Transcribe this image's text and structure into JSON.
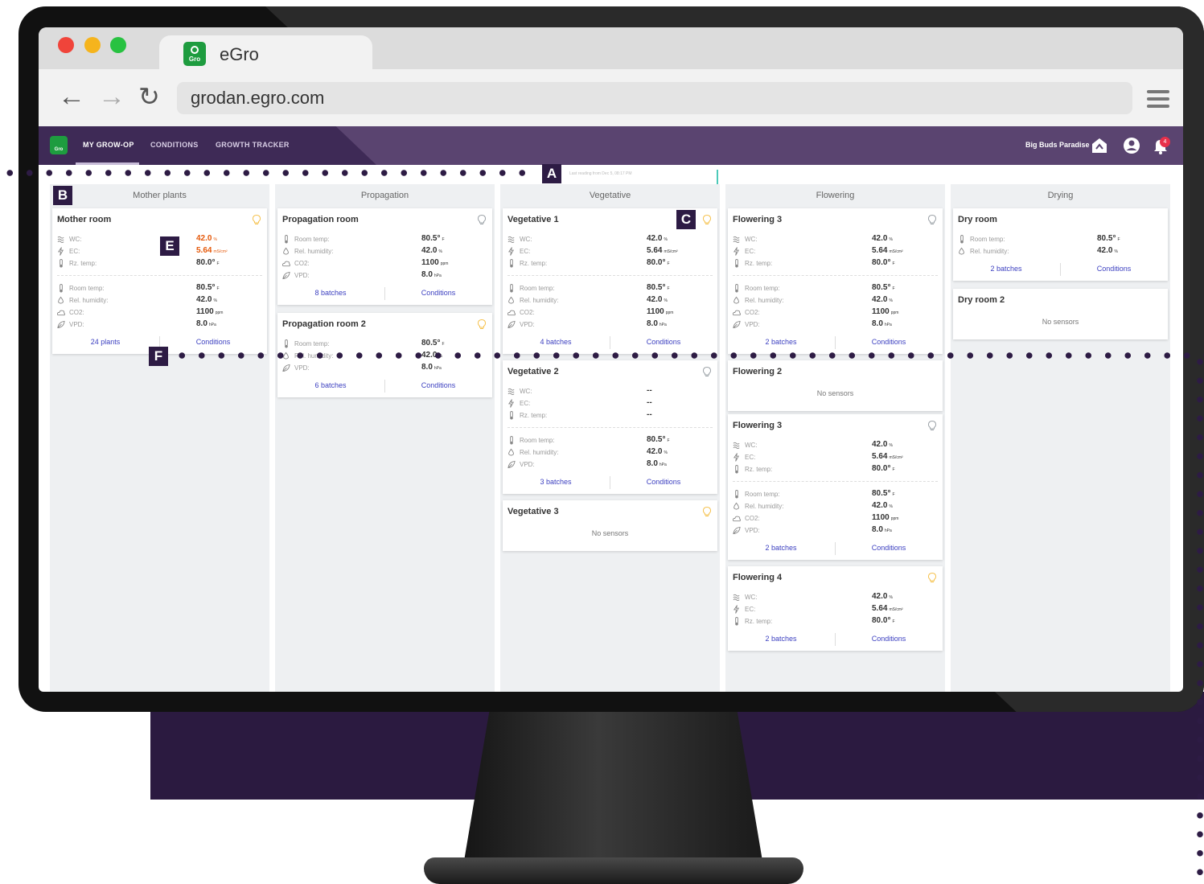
{
  "browser": {
    "tab_title": "eGro",
    "logo_text": "Gro",
    "url": "grodan.egro.com"
  },
  "app": {
    "logo_text": "Gro",
    "nav": [
      "MY GROW-OP",
      "CONDITIONS",
      "GROWTH TRACKER"
    ],
    "active_nav": "MY GROW-OP",
    "org_name": "Big Buds Paradise",
    "notification_count": "4",
    "last_reading": "Last reading from Dec 5, 08:17 PM"
  },
  "annotations": [
    "A",
    "B",
    "C",
    "E",
    "F"
  ],
  "colors": {
    "header": "#5a4470",
    "header_dark": "#3e2a56",
    "link": "#3b3fc0",
    "alert": "#e55a0c",
    "bulb_on": "#f5c04a",
    "bulb_off": "#9aa0a6"
  },
  "labels": {
    "wc": "WC:",
    "ec": "EC:",
    "rz": "Rz. temp:",
    "room": "Room temp:",
    "hum": "Rel. humidity:",
    "co2": "CO2:",
    "vpd": "VPD:",
    "batches": "batches",
    "conditions": "Conditions",
    "no_sensors": "No sensors"
  },
  "columns": [
    {
      "title": "Mother plants",
      "cards": [
        {
          "title": "Mother room",
          "bulb": "on",
          "substrate": [
            {
              "label": "WC:",
              "value": "42.0",
              "unit": "%",
              "alert": true
            },
            {
              "label": "EC:",
              "value": "5.64",
              "unit": "mS/cm²",
              "alert": true
            },
            {
              "label": "Rz. temp:",
              "value": "80.0°",
              "unit": "F"
            }
          ],
          "climate": [
            {
              "label": "Room temp:",
              "value": "80.5°",
              "unit": "F"
            },
            {
              "label": "Rel. humidity:",
              "value": "42.0",
              "unit": "%"
            },
            {
              "label": "CO2:",
              "value": "1100",
              "unit": "ppm"
            },
            {
              "label": "VPD:",
              "value": "8.0",
              "unit": "hPa"
            }
          ],
          "footer_left": "24 plants",
          "footer_right": "Conditions"
        }
      ]
    },
    {
      "title": "Propagation",
      "cards": [
        {
          "title": "Propagation room",
          "bulb": "off",
          "substrate": [],
          "climate": [
            {
              "label": "Room temp:",
              "value": "80.5°",
              "unit": "F"
            },
            {
              "label": "Rel. humidity:",
              "value": "42.0",
              "unit": "%"
            },
            {
              "label": "CO2:",
              "value": "1100",
              "unit": "ppm"
            },
            {
              "label": "VPD:",
              "value": "8.0",
              "unit": "hPa"
            }
          ],
          "footer_left": "8 batches",
          "footer_right": "Conditions"
        },
        {
          "title": "Propagation room 2",
          "bulb": "on",
          "substrate": [],
          "climate": [
            {
              "label": "Room temp:",
              "value": "80.5°",
              "unit": "F"
            },
            {
              "label": "Rel. humidity:",
              "value": "42.0",
              "unit": "%"
            },
            {
              "label": "VPD:",
              "value": "8.0",
              "unit": "hPa"
            }
          ],
          "footer_left": "6 batches",
          "footer_right": "Conditions"
        }
      ]
    },
    {
      "title": "Vegetative",
      "cards": [
        {
          "title": "Vegetative 1",
          "bulb": "on",
          "substrate": [
            {
              "label": "WC:",
              "value": "42.0",
              "unit": "%"
            },
            {
              "label": "EC:",
              "value": "5.64",
              "unit": "mS/cm²"
            },
            {
              "label": "Rz. temp:",
              "value": "80.0°",
              "unit": "F"
            }
          ],
          "climate": [
            {
              "label": "Room temp:",
              "value": "80.5°",
              "unit": "F"
            },
            {
              "label": "Rel. humidity:",
              "value": "42.0",
              "unit": "%"
            },
            {
              "label": "CO2:",
              "value": "1100",
              "unit": "ppm"
            },
            {
              "label": "VPD:",
              "value": "8.0",
              "unit": "hPa"
            }
          ],
          "footer_left": "4 batches",
          "footer_right": "Conditions"
        },
        {
          "title": "Vegetative 2",
          "bulb": "off",
          "substrate": [
            {
              "label": "WC:",
              "value": "--",
              "unit": ""
            },
            {
              "label": "EC:",
              "value": "--",
              "unit": ""
            },
            {
              "label": "Rz. temp:",
              "value": "--",
              "unit": ""
            }
          ],
          "climate": [
            {
              "label": "Room temp:",
              "value": "80.5°",
              "unit": "F"
            },
            {
              "label": "Rel. humidity:",
              "value": "42.0",
              "unit": "%"
            },
            {
              "label": "VPD:",
              "value": "8.0",
              "unit": "hPa"
            }
          ],
          "footer_left": "3 batches",
          "footer_right": "Conditions"
        },
        {
          "title": "Vegetative 3",
          "bulb": "on",
          "no_sensors": "No sensors"
        }
      ]
    },
    {
      "title": "Flowering",
      "cards": [
        {
          "title": "Flowering 3",
          "bulb": "off",
          "substrate": [
            {
              "label": "WC:",
              "value": "42.0",
              "unit": "%"
            },
            {
              "label": "EC:",
              "value": "5.64",
              "unit": "mS/cm²"
            },
            {
              "label": "Rz. temp:",
              "value": "80.0°",
              "unit": "F"
            }
          ],
          "climate": [
            {
              "label": "Room temp:",
              "value": "80.5°",
              "unit": "F"
            },
            {
              "label": "Rel. humidity:",
              "value": "42.0",
              "unit": "%"
            },
            {
              "label": "CO2:",
              "value": "1100",
              "unit": "ppm"
            },
            {
              "label": "VPD:",
              "value": "8.0",
              "unit": "hPa"
            }
          ],
          "footer_left": "2 batches",
          "footer_right": "Conditions"
        },
        {
          "title": "Flowering 2",
          "no_sensors": "No sensors"
        },
        {
          "title": "Flowering 3",
          "bulb": "off",
          "substrate": [
            {
              "label": "WC:",
              "value": "42.0",
              "unit": "%"
            },
            {
              "label": "EC:",
              "value": "5.64",
              "unit": "mS/cm²"
            },
            {
              "label": "Rz. temp:",
              "value": "80.0°",
              "unit": "F"
            }
          ],
          "climate": [
            {
              "label": "Room temp:",
              "value": "80.5°",
              "unit": "F"
            },
            {
              "label": "Rel. humidity:",
              "value": "42.0",
              "unit": "%"
            },
            {
              "label": "CO2:",
              "value": "1100",
              "unit": "ppm"
            },
            {
              "label": "VPD:",
              "value": "8.0",
              "unit": "hPa"
            }
          ],
          "footer_left": "2 batches",
          "footer_right": "Conditions"
        },
        {
          "title": "Flowering 4",
          "bulb": "on",
          "substrate": [
            {
              "label": "WC:",
              "value": "42.0",
              "unit": "%"
            },
            {
              "label": "EC:",
              "value": "5.64",
              "unit": "mS/cm²"
            },
            {
              "label": "Rz. temp:",
              "value": "80.0°",
              "unit": "F"
            }
          ],
          "climate": [],
          "footer_left": "2 batches",
          "footer_right": "Conditions"
        }
      ]
    },
    {
      "title": "Drying",
      "cards": [
        {
          "title": "Dry room",
          "substrate": [],
          "climate": [
            {
              "label": "Room temp:",
              "value": "80.5°",
              "unit": "F"
            },
            {
              "label": "Rel. humidity:",
              "value": "42.0",
              "unit": "%"
            }
          ],
          "footer_left": "2 batches",
          "footer_right": "Conditions"
        },
        {
          "title": "Dry room 2",
          "no_sensors": "No sensors"
        }
      ]
    }
  ]
}
